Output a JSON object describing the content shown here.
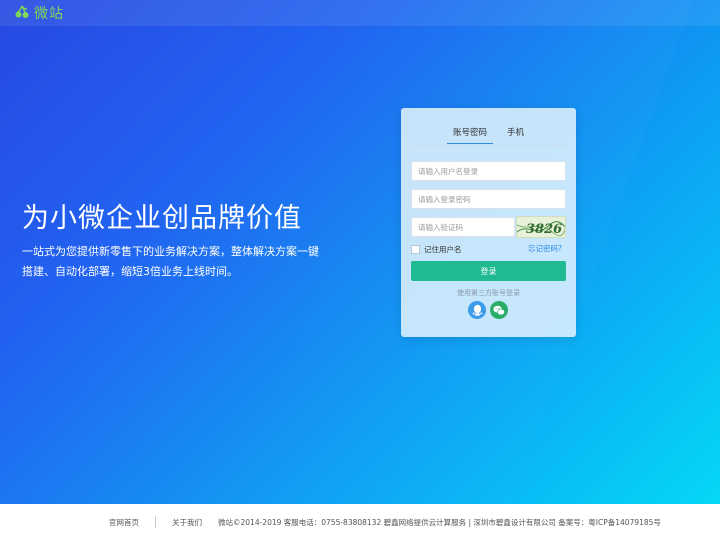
{
  "header": {
    "logo_text": "微站",
    "logo_icon": "cherry-icon"
  },
  "hero": {
    "headline": "为小微企业创品牌价值",
    "subline": "一站式为您提供新零售下的业务解决方案，整体解决方案一键搭建、自动化部署，缩短3倍业务上线时间。"
  },
  "login": {
    "tabs": [
      {
        "label": "账号密码",
        "active": true
      },
      {
        "label": "手机",
        "active": false
      }
    ],
    "username_placeholder": "请输入用户名登录",
    "password_placeholder": "请输入登录密码",
    "captcha_placeholder": "请输入验证码",
    "captcha_text": "3826",
    "remember_label": "记住用户名",
    "forgot_label": "忘记密码?",
    "submit_label": "登录",
    "third_party_label": "使用第三方账号登录",
    "third_party": [
      {
        "name": "qq",
        "icon": "qq-icon",
        "color": "#3d9be9"
      },
      {
        "name": "wechat",
        "icon": "wechat-icon",
        "color": "#2aae67"
      }
    ]
  },
  "footer": {
    "links": [
      "官网首页",
      "关于我们"
    ],
    "copyright": "微站©2014-2019 客服电话：0755-83808132 碧鑫网络提供云计算服务 | 深圳市碧鑫设计有限公司 备案号：粤ICP备14079185号"
  },
  "colors": {
    "accent_green": "#1fb992",
    "link_blue": "#2f8ae6",
    "logo_green": "#7ed957"
  }
}
